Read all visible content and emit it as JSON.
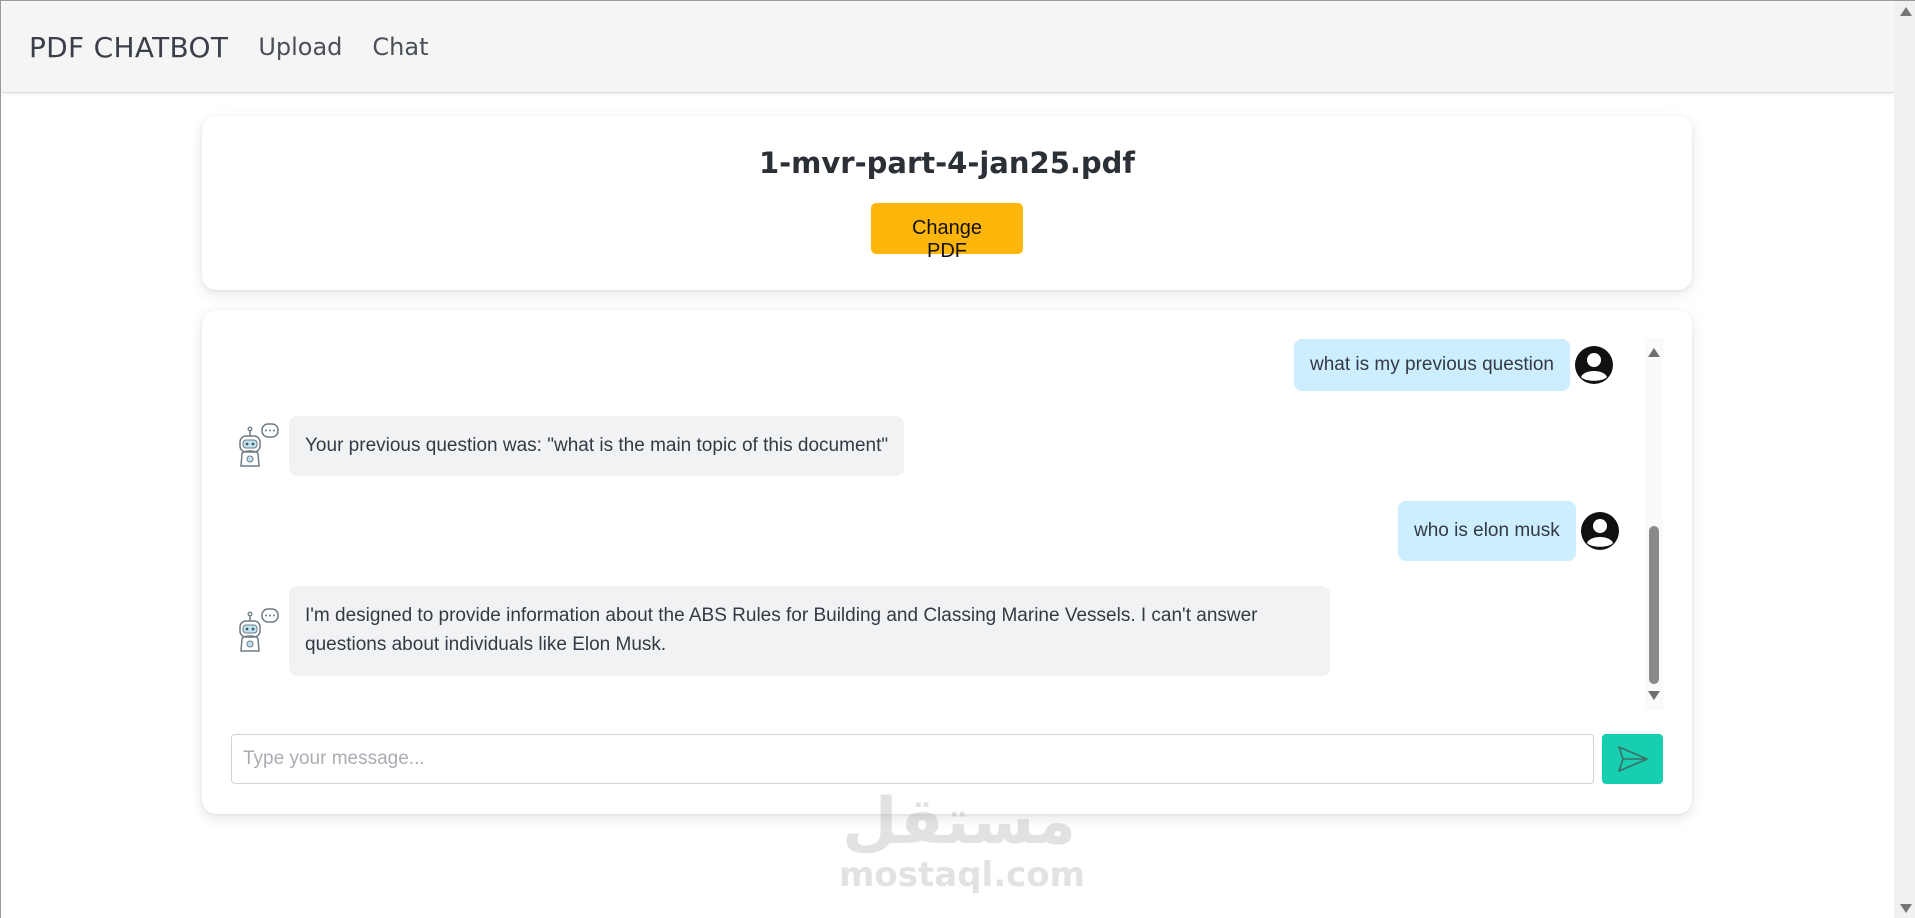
{
  "navbar": {
    "brand": "PDF CHATBOT",
    "links": [
      "Upload",
      "Chat"
    ]
  },
  "document": {
    "file_name": "1-mvr-part-4-jan25.pdf",
    "change_button": "Change PDF"
  },
  "chat": {
    "messages": [
      {
        "role": "user",
        "text": "what is my previous question"
      },
      {
        "role": "bot",
        "text": "Your previous question was: \"what is the main topic of this document\""
      },
      {
        "role": "user",
        "text": "who is elon musk"
      },
      {
        "role": "bot",
        "text": "I'm designed to provide information about the ABS Rules for Building and Classing Marine Vessels. I can't answer questions about individuals like Elon Musk."
      }
    ],
    "input_value": "",
    "input_placeholder": "Type your message..."
  },
  "watermark": {
    "arabic": "مستقل",
    "latin": "mostaql.com"
  },
  "colors": {
    "accent_yellow": "#ffb60a",
    "send_teal": "#17cfb0",
    "user_bubble": "#cdeeff",
    "bot_bubble": "#f1f2f4"
  },
  "icons": {
    "user_avatar": "user-circle-icon",
    "bot_avatar": "robot-icon",
    "send": "send-paper-plane-icon"
  }
}
